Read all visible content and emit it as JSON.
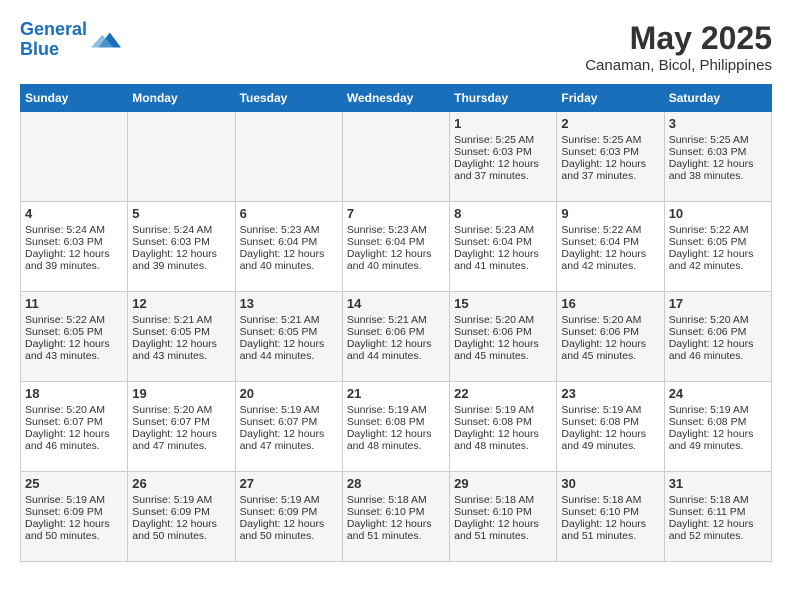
{
  "header": {
    "logo_line1": "General",
    "logo_line2": "Blue",
    "title": "May 2025",
    "subtitle": "Canaman, Bicol, Philippines"
  },
  "days_of_week": [
    "Sunday",
    "Monday",
    "Tuesday",
    "Wednesday",
    "Thursday",
    "Friday",
    "Saturday"
  ],
  "weeks": [
    [
      {
        "day": "",
        "content": ""
      },
      {
        "day": "",
        "content": ""
      },
      {
        "day": "",
        "content": ""
      },
      {
        "day": "",
        "content": ""
      },
      {
        "day": "1",
        "content": "Sunrise: 5:25 AM\nSunset: 6:03 PM\nDaylight: 12 hours and 37 minutes."
      },
      {
        "day": "2",
        "content": "Sunrise: 5:25 AM\nSunset: 6:03 PM\nDaylight: 12 hours and 37 minutes."
      },
      {
        "day": "3",
        "content": "Sunrise: 5:25 AM\nSunset: 6:03 PM\nDaylight: 12 hours and 38 minutes."
      }
    ],
    [
      {
        "day": "4",
        "content": "Sunrise: 5:24 AM\nSunset: 6:03 PM\nDaylight: 12 hours and 39 minutes."
      },
      {
        "day": "5",
        "content": "Sunrise: 5:24 AM\nSunset: 6:03 PM\nDaylight: 12 hours and 39 minutes."
      },
      {
        "day": "6",
        "content": "Sunrise: 5:23 AM\nSunset: 6:04 PM\nDaylight: 12 hours and 40 minutes."
      },
      {
        "day": "7",
        "content": "Sunrise: 5:23 AM\nSunset: 6:04 PM\nDaylight: 12 hours and 40 minutes."
      },
      {
        "day": "8",
        "content": "Sunrise: 5:23 AM\nSunset: 6:04 PM\nDaylight: 12 hours and 41 minutes."
      },
      {
        "day": "9",
        "content": "Sunrise: 5:22 AM\nSunset: 6:04 PM\nDaylight: 12 hours and 42 minutes."
      },
      {
        "day": "10",
        "content": "Sunrise: 5:22 AM\nSunset: 6:05 PM\nDaylight: 12 hours and 42 minutes."
      }
    ],
    [
      {
        "day": "11",
        "content": "Sunrise: 5:22 AM\nSunset: 6:05 PM\nDaylight: 12 hours and 43 minutes."
      },
      {
        "day": "12",
        "content": "Sunrise: 5:21 AM\nSunset: 6:05 PM\nDaylight: 12 hours and 43 minutes."
      },
      {
        "day": "13",
        "content": "Sunrise: 5:21 AM\nSunset: 6:05 PM\nDaylight: 12 hours and 44 minutes."
      },
      {
        "day": "14",
        "content": "Sunrise: 5:21 AM\nSunset: 6:06 PM\nDaylight: 12 hours and 44 minutes."
      },
      {
        "day": "15",
        "content": "Sunrise: 5:20 AM\nSunset: 6:06 PM\nDaylight: 12 hours and 45 minutes."
      },
      {
        "day": "16",
        "content": "Sunrise: 5:20 AM\nSunset: 6:06 PM\nDaylight: 12 hours and 45 minutes."
      },
      {
        "day": "17",
        "content": "Sunrise: 5:20 AM\nSunset: 6:06 PM\nDaylight: 12 hours and 46 minutes."
      }
    ],
    [
      {
        "day": "18",
        "content": "Sunrise: 5:20 AM\nSunset: 6:07 PM\nDaylight: 12 hours and 46 minutes."
      },
      {
        "day": "19",
        "content": "Sunrise: 5:20 AM\nSunset: 6:07 PM\nDaylight: 12 hours and 47 minutes."
      },
      {
        "day": "20",
        "content": "Sunrise: 5:19 AM\nSunset: 6:07 PM\nDaylight: 12 hours and 47 minutes."
      },
      {
        "day": "21",
        "content": "Sunrise: 5:19 AM\nSunset: 6:08 PM\nDaylight: 12 hours and 48 minutes."
      },
      {
        "day": "22",
        "content": "Sunrise: 5:19 AM\nSunset: 6:08 PM\nDaylight: 12 hours and 48 minutes."
      },
      {
        "day": "23",
        "content": "Sunrise: 5:19 AM\nSunset: 6:08 PM\nDaylight: 12 hours and 49 minutes."
      },
      {
        "day": "24",
        "content": "Sunrise: 5:19 AM\nSunset: 6:08 PM\nDaylight: 12 hours and 49 minutes."
      }
    ],
    [
      {
        "day": "25",
        "content": "Sunrise: 5:19 AM\nSunset: 6:09 PM\nDaylight: 12 hours and 50 minutes."
      },
      {
        "day": "26",
        "content": "Sunrise: 5:19 AM\nSunset: 6:09 PM\nDaylight: 12 hours and 50 minutes."
      },
      {
        "day": "27",
        "content": "Sunrise: 5:19 AM\nSunset: 6:09 PM\nDaylight: 12 hours and 50 minutes."
      },
      {
        "day": "28",
        "content": "Sunrise: 5:18 AM\nSunset: 6:10 PM\nDaylight: 12 hours and 51 minutes."
      },
      {
        "day": "29",
        "content": "Sunrise: 5:18 AM\nSunset: 6:10 PM\nDaylight: 12 hours and 51 minutes."
      },
      {
        "day": "30",
        "content": "Sunrise: 5:18 AM\nSunset: 6:10 PM\nDaylight: 12 hours and 51 minutes."
      },
      {
        "day": "31",
        "content": "Sunrise: 5:18 AM\nSunset: 6:11 PM\nDaylight: 12 hours and 52 minutes."
      }
    ]
  ]
}
